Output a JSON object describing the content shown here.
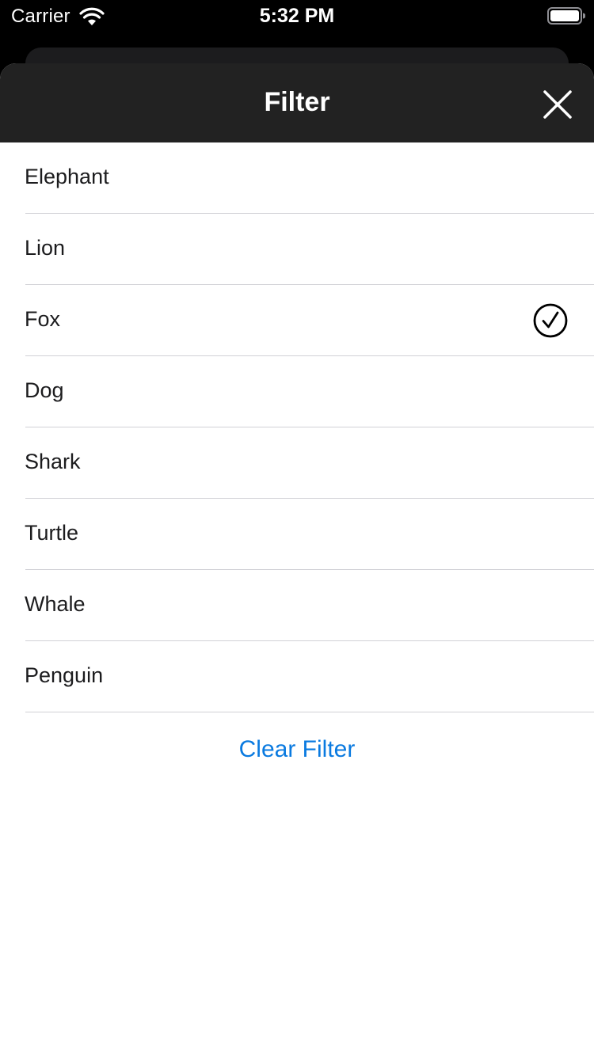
{
  "status_bar": {
    "carrier": "Carrier",
    "time": "5:32 PM",
    "wifi_icon": "wifi-icon",
    "battery_icon": "battery-icon"
  },
  "nav": {
    "title": "Filter",
    "close_icon": "close-icon"
  },
  "filter_list": {
    "items": [
      {
        "label": "Elephant",
        "selected": false
      },
      {
        "label": "Lion",
        "selected": false
      },
      {
        "label": "Fox",
        "selected": true
      },
      {
        "label": "Dog",
        "selected": false
      },
      {
        "label": "Shark",
        "selected": false
      },
      {
        "label": "Turtle",
        "selected": false
      },
      {
        "label": "Whale",
        "selected": false
      },
      {
        "label": "Penguin",
        "selected": false
      }
    ],
    "selected_icon": "checkmark-circle-icon"
  },
  "clear_filter_label": "Clear Filter",
  "colors": {
    "nav_background": "#222222",
    "accent": "#0a7ae0",
    "text": "#1c1c1e",
    "divider": "#d1d1d6"
  }
}
